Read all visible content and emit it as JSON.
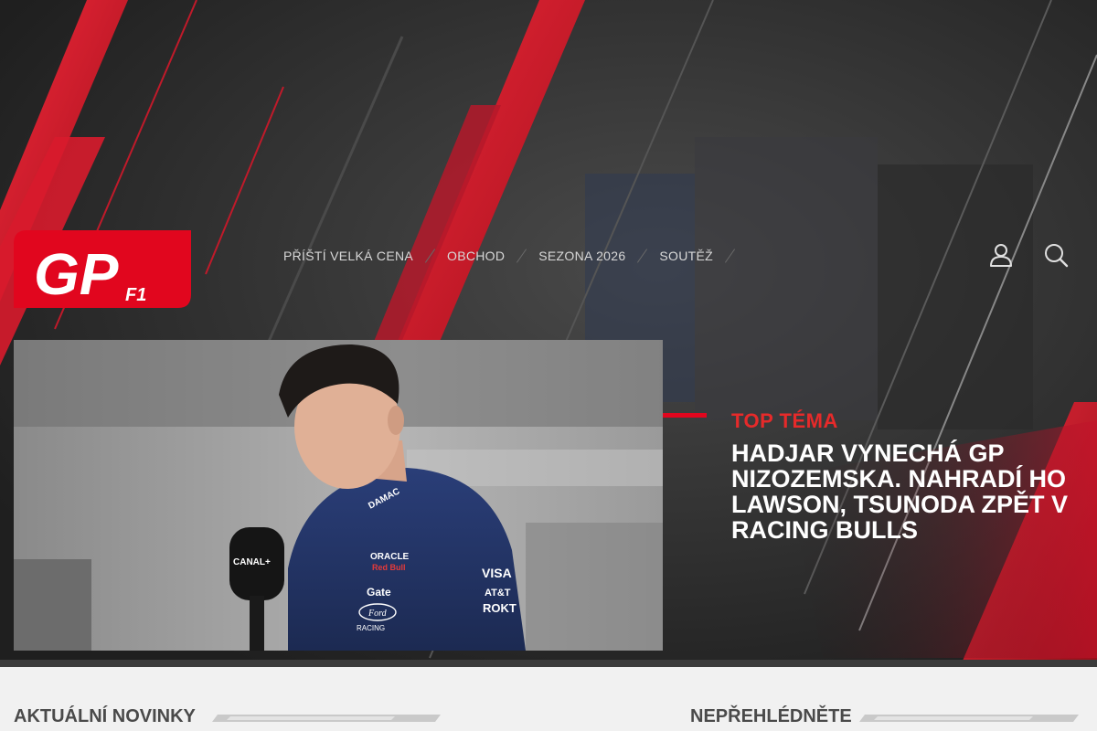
{
  "site": {
    "logo_text": "GP",
    "logo_subtext": "F1",
    "colors": {
      "brand_red": "#e1061e",
      "dark_bg": "#262626",
      "light_bg": "#f1f1f1"
    }
  },
  "nav": {
    "items": [
      {
        "label": "PŘÍŠTÍ VELKÁ CENA"
      },
      {
        "label": "OBCHOD"
      },
      {
        "label": "SEZONA 2026"
      },
      {
        "label": "SOUTĚŽ"
      }
    ]
  },
  "header_icons": {
    "account": "user-icon",
    "search": "search-icon"
  },
  "hero": {
    "topic_label": "TOP TÉMA",
    "headline": "HADJAR VYNECHÁ GP NIZOZEMSKA. NAHRADÍ HO LAWSON, TSUNODA ZPĚT V RACING BULLS",
    "image_text": {
      "sponsor_1": "ORACLE",
      "sponsor_2": "Red Bull",
      "sponsor_3": "Gate",
      "sponsor_4": "Ford",
      "sponsor_5": "RACING",
      "sponsor_6": "VISA",
      "sponsor_7": "AT&T",
      "sponsor_8": "ROKT",
      "sponsor_9": "DAMAC",
      "mic_label": "CANAL+"
    }
  },
  "sections": {
    "left_title": "AKTUÁLNÍ NOVINKY",
    "right_title": "NEPŘEHLÉDNĚTE"
  }
}
